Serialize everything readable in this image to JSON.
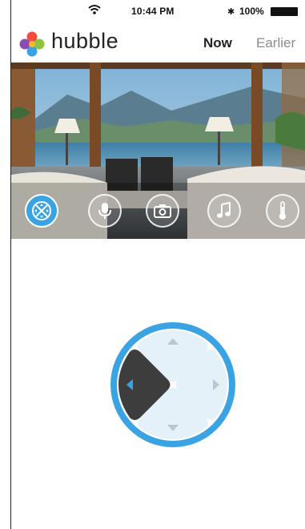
{
  "status_bar": {
    "time": "10:44 PM",
    "bluetooth": "✱",
    "battery": "100%"
  },
  "header": {
    "brand": "hubble",
    "tabs": {
      "now": "Now",
      "earlier": "Earlier"
    }
  },
  "controls": [
    {
      "name": "pan-tilt",
      "icon": "dpad-icon",
      "active": true
    },
    {
      "name": "talk",
      "icon": "microphone-icon",
      "active": false
    },
    {
      "name": "snapshot",
      "icon": "camera-icon",
      "active": false
    },
    {
      "name": "lullaby",
      "icon": "music-note-icon",
      "active": false
    },
    {
      "name": "temperature",
      "icon": "thermometer-icon",
      "active": false
    }
  ],
  "dpad": {
    "pressed_direction": "left",
    "ring_color": "#3aa3e3",
    "pad_color": "#e4f1f8",
    "pressed_color": "#3d3d3d"
  },
  "colors": {
    "accent": "#3aa3e3",
    "tab_active": "#222222",
    "tab_inactive": "#8a8a8a"
  }
}
